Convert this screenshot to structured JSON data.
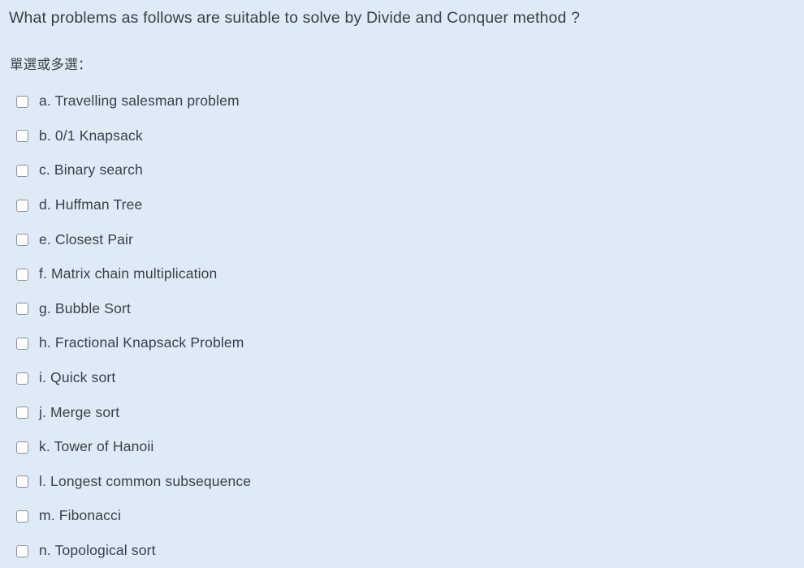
{
  "question": {
    "text": "What problems as follows are suitable to solve by Divide and Conquer method ?"
  },
  "answer": {
    "choice_prompt": "單選或多選：",
    "options": [
      {
        "label": "a. Travelling salesman problem",
        "checked": false
      },
      {
        "label": "b. 0/1 Knapsack",
        "checked": false
      },
      {
        "label": "c. Binary search",
        "checked": false
      },
      {
        "label": "d. Huffman Tree",
        "checked": false
      },
      {
        "label": "e. Closest Pair",
        "checked": false
      },
      {
        "label": "f. Matrix chain multiplication",
        "checked": false
      },
      {
        "label": "g. Bubble Sort",
        "checked": false
      },
      {
        "label": "h. Fractional Knapsack Problem",
        "checked": false
      },
      {
        "label": "i. Quick sort",
        "checked": false
      },
      {
        "label": "j. Merge sort",
        "checked": false
      },
      {
        "label": "k. Tower of Hanoii",
        "checked": false
      },
      {
        "label": "l. Longest common subsequence",
        "checked": false
      },
      {
        "label": "m. Fibonacci",
        "checked": false
      },
      {
        "label": "n. Topological sort",
        "checked": false
      }
    ]
  },
  "colors": {
    "background": "#dfeaf7",
    "text": "#3a3f45",
    "checkbox_border": "#8a9199",
    "checkbox_fill": "#ffffff"
  }
}
